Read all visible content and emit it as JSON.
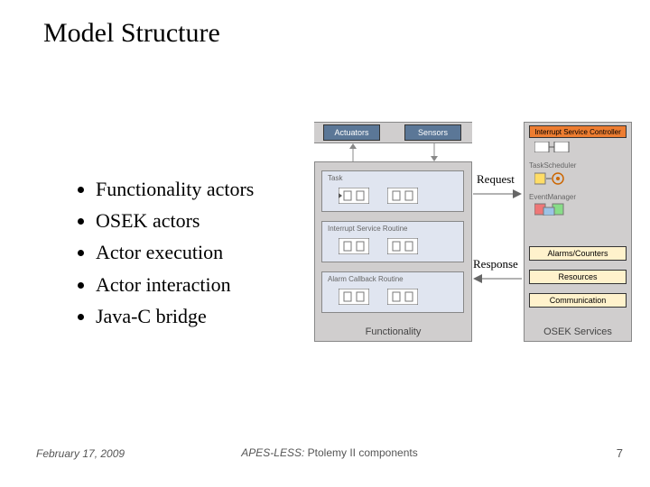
{
  "slide": {
    "title": "Model Structure",
    "bullets": [
      "Functionality actors",
      "OSEK actors",
      "Actor execution",
      "Actor interaction",
      "Java-C bridge"
    ]
  },
  "diagram": {
    "top_boxes": [
      "Actuators",
      "Sensors"
    ],
    "left_column_title": "Functionality",
    "left_rows": [
      "Task",
      "Interrupt Service Routine",
      "Alarm Callback Routine"
    ],
    "right_title": "OSEK Services",
    "right_rows": [
      "Interrupt Service Controller",
      "TaskScheduler",
      "EventManager",
      "",
      "Alarms/Counters",
      "Resources",
      "Communication"
    ],
    "flow_labels": {
      "request": "Request",
      "response": "Response"
    }
  },
  "footer": {
    "date": "February 17, 2009",
    "caption_prefix": "APES-LESS:",
    "caption_rest": " Ptolemy II components",
    "page": "7"
  }
}
